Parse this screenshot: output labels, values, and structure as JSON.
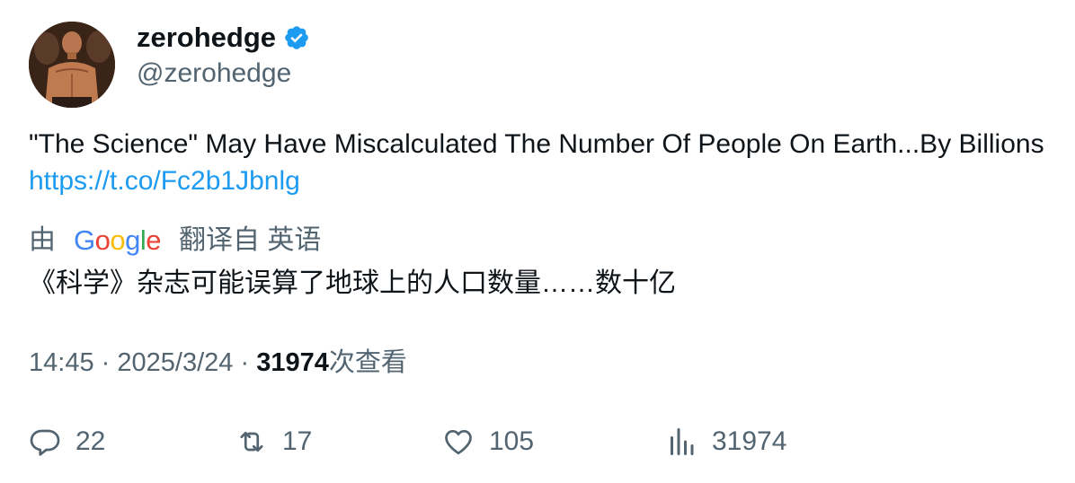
{
  "author": {
    "name": "zerohedge",
    "handle": "@zerohedge",
    "verified_color": "#1d9bf0"
  },
  "tweet": {
    "text": "\"The Science\" May Have Miscalculated The Number Of People On Earth...By Billions",
    "link": "https://t.co/Fc2b1Jbnlg"
  },
  "translation": {
    "prefix": "由",
    "provider_letters": [
      "G",
      "o",
      "o",
      "g",
      "l",
      "e"
    ],
    "suffix": "翻译自 英语",
    "text": "《科学》杂志可能误算了地球上的人口数量……数十亿"
  },
  "meta": {
    "time": "14:45",
    "separator": "·",
    "date": "2025/3/24",
    "views": "31974",
    "views_label": "次查看"
  },
  "actions": {
    "replies": "22",
    "retweets": "17",
    "likes": "105",
    "views": "31974"
  },
  "icons": {
    "reply": "reply-icon",
    "retweet": "retweet-icon",
    "like": "heart-icon",
    "views": "bar-chart-icon",
    "verified": "verified-badge-icon"
  },
  "colors": {
    "link": "#1d9bf0",
    "secondary_text": "#536471",
    "primary_text": "#0f1419"
  }
}
